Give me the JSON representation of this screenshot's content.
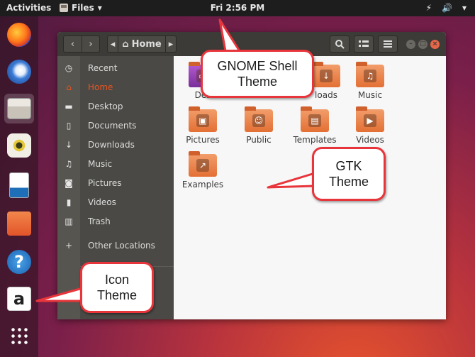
{
  "topbar": {
    "activities": "Activities",
    "app_menu": "Files",
    "app_menu_arrow": "▾",
    "clock": "Fri  2:56 PM",
    "tray": [
      "⚡",
      "🔊",
      "▾"
    ]
  },
  "dock": {
    "items": [
      "firefox",
      "thunderbird",
      "files",
      "rhythmbox",
      "libreoffice-writer",
      "ubuntu-software",
      "help",
      "amazon"
    ],
    "help_glyph": "?",
    "amazon_glyph": "a"
  },
  "window": {
    "breadcrumb": "Home",
    "sidebar": {
      "items": [
        {
          "label": "Recent",
          "icon": "clock-icon"
        },
        {
          "label": "Home",
          "icon": "home-icon"
        },
        {
          "label": "Desktop",
          "icon": "folder-icon"
        },
        {
          "label": "Documents",
          "icon": "document-icon"
        },
        {
          "label": "Downloads",
          "icon": "download-icon"
        },
        {
          "label": "Music",
          "icon": "music-icon"
        },
        {
          "label": "Pictures",
          "icon": "camera-icon"
        },
        {
          "label": "Videos",
          "icon": "video-icon"
        },
        {
          "label": "Trash",
          "icon": "trash-icon"
        },
        {
          "label": "Other Locations",
          "icon": "plus-icon"
        }
      ]
    },
    "files": [
      {
        "label": "Des",
        "emblem": "▭"
      },
      {
        "label": "loads",
        "emblem": "↓"
      },
      {
        "label": "Music",
        "emblem": "♫"
      },
      {
        "label": "Pictures",
        "emblem": "▣"
      },
      {
        "label": "Public",
        "emblem": "☺"
      },
      {
        "label": "Templates",
        "emblem": "▤"
      },
      {
        "label": "Videos",
        "emblem": "▶"
      },
      {
        "label": "Examples",
        "emblem": "↗"
      }
    ]
  },
  "callouts": {
    "gnome_line1": "GNOME Shell",
    "gnome_line2": "Theme",
    "gtk_line1": "GTK",
    "gtk_line2": "Theme",
    "icon_line1": "Icon",
    "icon_line2": "Theme"
  },
  "colors": {
    "accent": "#e95420",
    "callout_border": "#e8353b",
    "headerbar": "#3c3b37"
  }
}
